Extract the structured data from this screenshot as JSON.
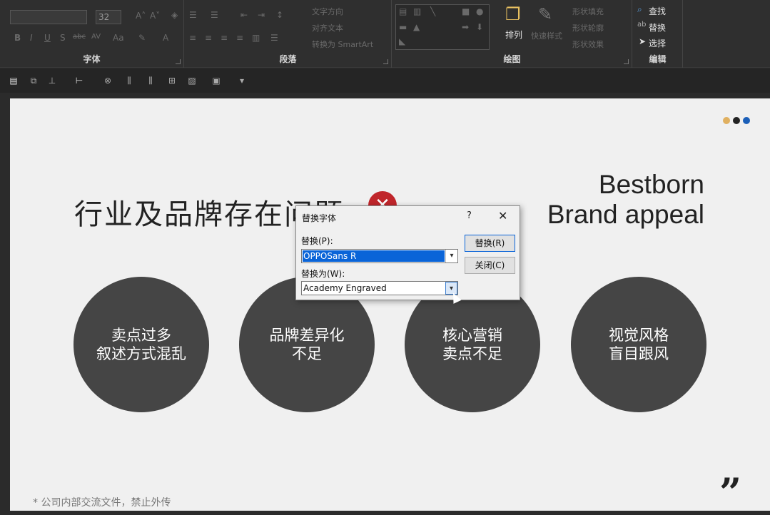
{
  "ribbon": {
    "groups": {
      "font": "字体",
      "paragraph": "段落",
      "drawing": "绘图",
      "editing": "编辑"
    },
    "font_size": "32",
    "text_direction": "文字方向",
    "align_text": "对齐文本",
    "convert_smartart": "转换为 SmartArt",
    "arrange": "排列",
    "quick_styles": "快速样式",
    "shape_fill": "形状填充",
    "shape_outline": "形状轮廓",
    "shape_effects": "形状效果",
    "find": "查找",
    "replace": "替换",
    "select": "选择"
  },
  "slide": {
    "title": "行业及品牌存在问题",
    "brand_line1": "Bestborn",
    "brand_line2": "Brand appeal",
    "dot_colors": [
      "#e0b060",
      "#222222",
      "#1b5fb8"
    ],
    "circles": [
      {
        "line1": "卖点过多",
        "line2": "叙述方式混乱"
      },
      {
        "line1": "品牌差异化",
        "line2": "不足"
      },
      {
        "line1": "核心营销",
        "line2": "卖点不足"
      },
      {
        "line1": "视觉风格",
        "line2": "盲目跟风"
      }
    ],
    "footnote": "* 公司内部交流文件，禁止外传",
    "quote_mark": "”"
  },
  "dialog": {
    "title": "替换字体",
    "help": "?",
    "close": "✕",
    "replace_label": "替换(P):",
    "replace_value": "OPPOSans R",
    "with_label": "替换为(W):",
    "with_value": "Academy Engraved",
    "replace_button": "替换(R)",
    "close_button": "关闭(C)"
  }
}
